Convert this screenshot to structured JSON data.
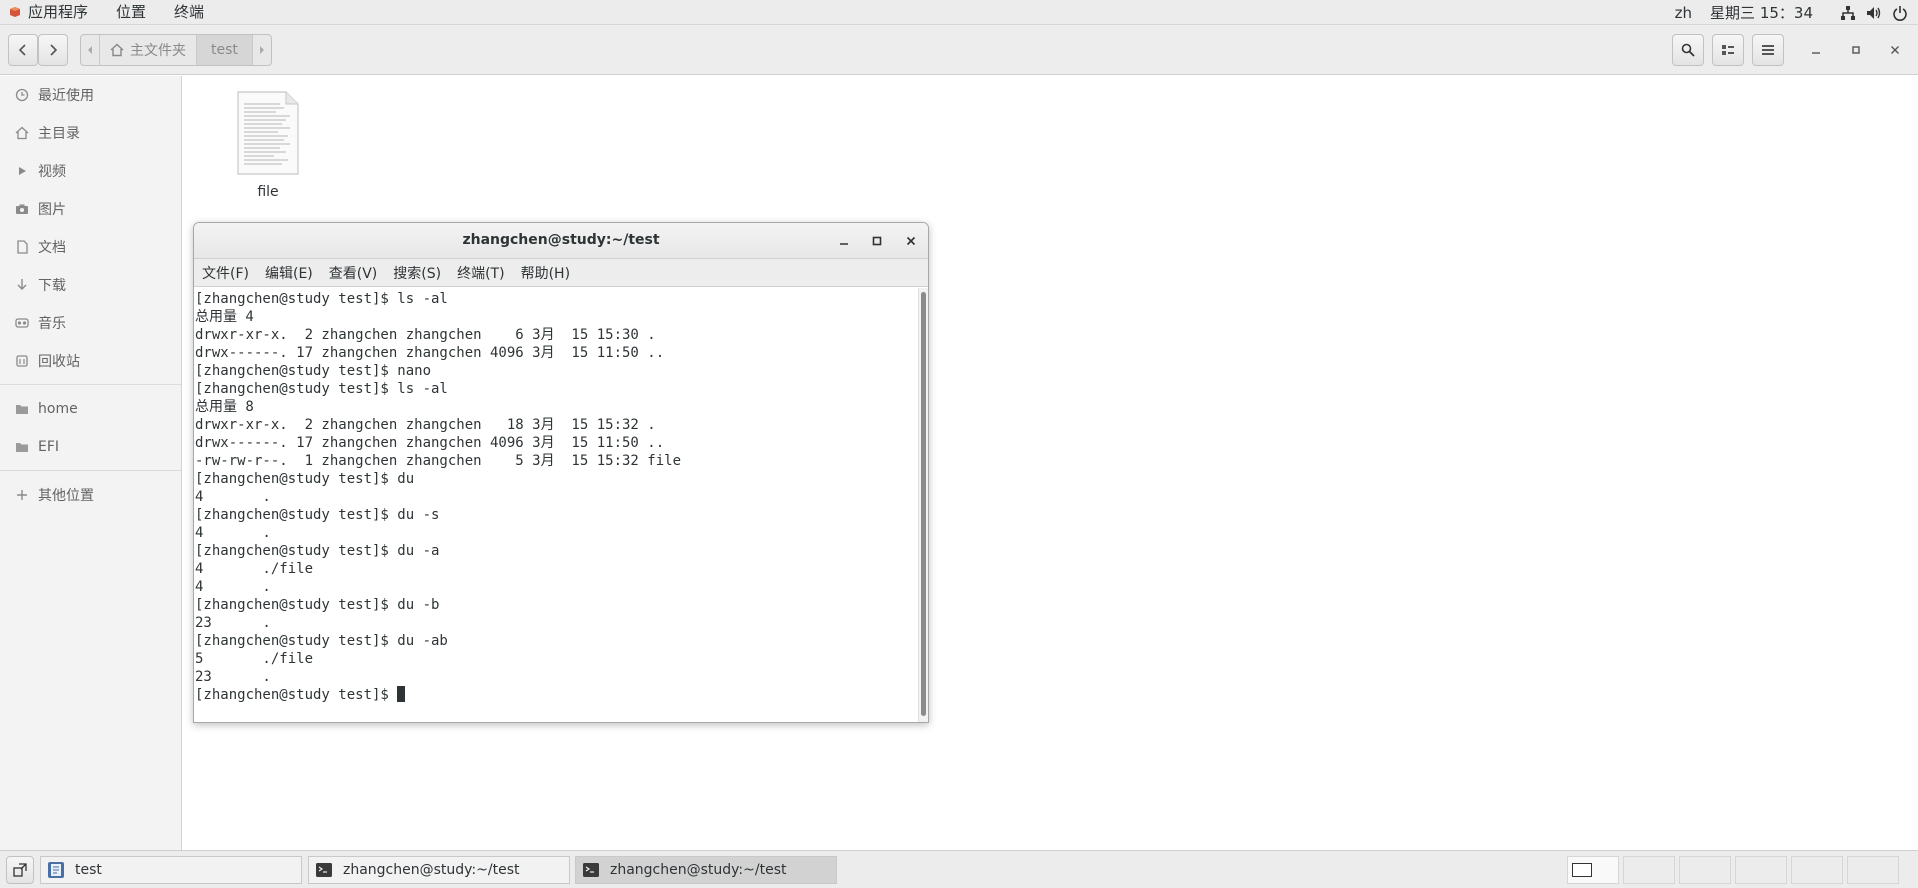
{
  "topbar": {
    "menu": [
      "应用程序",
      "位置",
      "终端"
    ],
    "lang": "zh",
    "datetime": "星期三 15：34"
  },
  "filemanager": {
    "path": [
      "主文件夹",
      "test"
    ],
    "sidebar": {
      "places": [
        "最近使用",
        "主目录",
        "视频",
        "图片",
        "文档",
        "下载",
        "音乐",
        "回收站"
      ],
      "devices": [
        "home",
        "EFI"
      ],
      "other": "其他位置"
    },
    "files": [
      {
        "name": "file",
        "icon": "text-document-icon"
      }
    ]
  },
  "terminal": {
    "title": "zhangchen@study:~/test",
    "menu": [
      "文件(F)",
      "编辑(E)",
      "查看(V)",
      "搜索(S)",
      "终端(T)",
      "帮助(H)"
    ],
    "lines": [
      "[zhangchen@study test]$ ls -al",
      "总用量 4",
      "drwxr-xr-x.  2 zhangchen zhangchen    6 3月  15 15:30 .",
      "drwx------. 17 zhangchen zhangchen 4096 3月  15 11:50 ..",
      "[zhangchen@study test]$ nano",
      "[zhangchen@study test]$ ls -al",
      "总用量 8",
      "drwxr-xr-x.  2 zhangchen zhangchen   18 3月  15 15:32 .",
      "drwx------. 17 zhangchen zhangchen 4096 3月  15 11:50 ..",
      "-rw-rw-r--.  1 zhangchen zhangchen    5 3月  15 15:32 file",
      "[zhangchen@study test]$ du",
      "4       .",
      "[zhangchen@study test]$ du -s",
      "4       .",
      "[zhangchen@study test]$ du -a",
      "4       ./file",
      "4       .",
      "[zhangchen@study test]$ du -b",
      "23      .",
      "[zhangchen@study test]$ du -ab",
      "5       ./file",
      "23      .",
      "[zhangchen@study test]$ "
    ]
  },
  "taskbar": {
    "tasks": [
      "test",
      "zhangchen@study:~/test",
      "zhangchen@study:~/test"
    ]
  },
  "colors": {
    "panel": "#ececec",
    "sidebar": "#f3f3f3",
    "text": "#2e3436",
    "active_task": "#d2d2d2"
  }
}
